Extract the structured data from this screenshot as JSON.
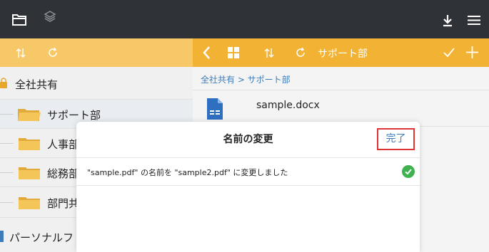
{
  "toolbar": {
    "icons": [
      "folder-icon",
      "layers-icon",
      "download-icon",
      "menu-icon"
    ]
  },
  "subbar": {
    "nav_title": "サポート部",
    "icons": [
      "sort-icon",
      "refresh-icon",
      "back-icon",
      "grid-view-icon",
      "check-icon",
      "add-icon"
    ]
  },
  "sidebar": {
    "root_label": "全社共有",
    "items": [
      {
        "label": "サポート部"
      },
      {
        "label": "人事部"
      },
      {
        "label": "総務部"
      },
      {
        "label": "部門共"
      }
    ],
    "personal_label": "パーソナルフ"
  },
  "main": {
    "breadcrumb": "全社共有 > サポート部",
    "file_name": "sample.docx"
  },
  "dialog": {
    "title": "名前の変更",
    "done_label": "完了",
    "message": "\"sample.pdf\" の名前を \"sample2.pdf\" に変更しました"
  },
  "colors": {
    "topbar": "#2f3236",
    "accent": "#f2b233",
    "link": "#3e7bb9",
    "success": "#3fb14f"
  }
}
